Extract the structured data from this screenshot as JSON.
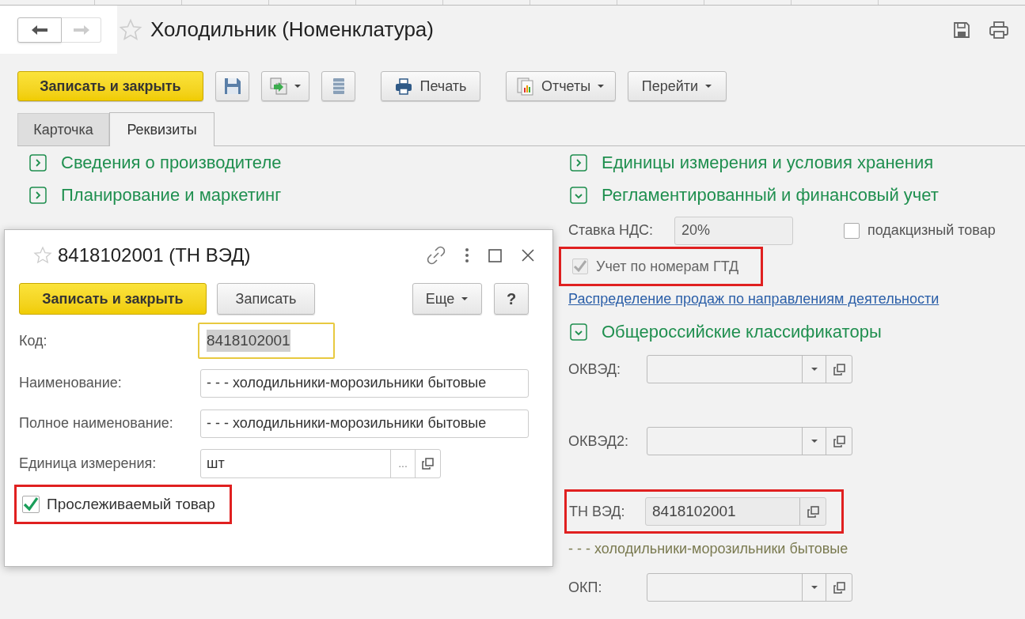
{
  "window": {
    "title": "Холодильник (Номенклатура)"
  },
  "toolbar": [
    {
      "kind": "primary",
      "label": "Записать и закрыть"
    },
    {
      "kind": "save"
    },
    {
      "kind": "copy",
      "dropdown": true
    },
    {
      "kind": "list"
    },
    {
      "kind": "print",
      "label": "Печать"
    },
    {
      "kind": "reports",
      "label": "Отчеты",
      "dropdown": true
    },
    {
      "kind": "plain",
      "label": "Перейти",
      "dropdown": true
    }
  ],
  "tabs": [
    {
      "label": "Карточка",
      "selected": false
    },
    {
      "label": "Реквизиты",
      "selected": true
    }
  ],
  "left_sections": [
    {
      "title": "Сведения о производителе",
      "expanded": false
    },
    {
      "title": "Планирование и маркетинг",
      "expanded": false
    }
  ],
  "right_rows": [
    {
      "kind": "section",
      "title": "Единицы измерения и условия хранения",
      "expanded": false
    },
    {
      "kind": "section",
      "title": "Регламентированный и финансовый учет",
      "expanded": true
    },
    {
      "kind": "vat",
      "label": "Ставка НДС:",
      "value": "20%",
      "check_label": "подакцизный товар",
      "checked": false
    },
    {
      "kind": "checkbox",
      "label": "Учет по номерам ГТД",
      "checked": true,
      "disabled": true,
      "highlighted": true
    },
    {
      "kind": "link",
      "label": "Распределение продаж по направлениям деятельности"
    },
    {
      "kind": "section",
      "title": "Общероссийские классификаторы",
      "expanded": true
    },
    {
      "kind": "select",
      "label": "ОКВЭД:"
    },
    {
      "kind": "select",
      "label": "ОКВЭД2:"
    },
    {
      "kind": "code",
      "label": "ТН ВЭД:",
      "value": "8418102001",
      "highlighted": true
    },
    {
      "kind": "note",
      "text": "- - - холодильники-морозильники бытовые"
    },
    {
      "kind": "select",
      "label": "ОКП:"
    }
  ],
  "dialog": {
    "title": "8418102001 (ТН ВЭД)",
    "buttons": [
      {
        "kind": "primary",
        "label": "Записать и закрыть"
      },
      {
        "kind": "plain",
        "label": "Записать"
      },
      {
        "kind": "menu",
        "label": "Еще"
      },
      {
        "kind": "help",
        "label": "?"
      }
    ],
    "fields": [
      {
        "kind": "code",
        "label": "Код:",
        "value": "8418102001",
        "focused": true
      },
      {
        "kind": "text",
        "label": "Наименование:",
        "value": "- - - холодильники-морозильники бытовые"
      },
      {
        "kind": "text",
        "label": "Полное наименование:",
        "value": "- - - холодильники-морозильники бытовые"
      },
      {
        "kind": "choice",
        "label": "Единица измерения:",
        "value": "шт",
        "button_text": "..."
      }
    ],
    "checkbox": {
      "label": "Прослеживаемый товар",
      "checked": true,
      "highlighted": true
    }
  }
}
